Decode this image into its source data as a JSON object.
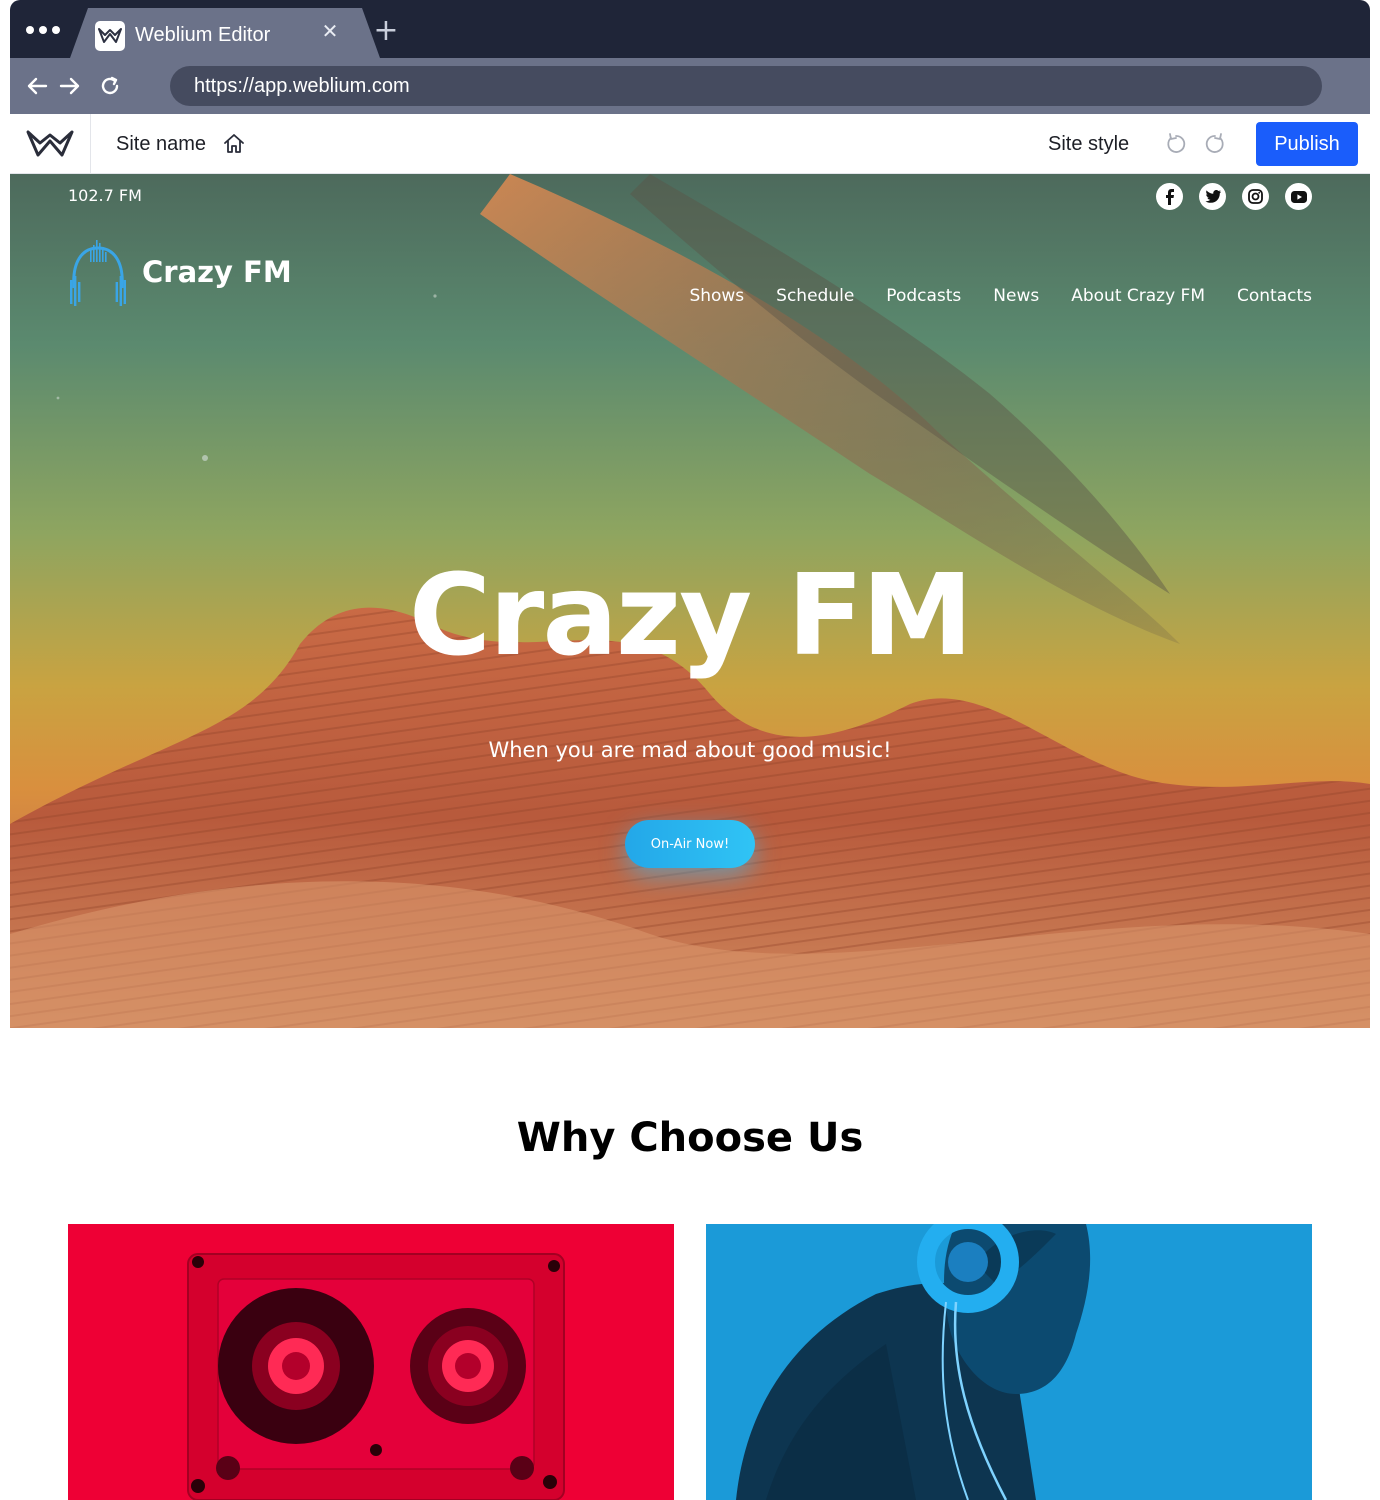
{
  "browser": {
    "tab_title": "Weblium Editor",
    "url": "https://app.weblium.com",
    "icons": [
      "menu-dots-icon",
      "weblium-favicon-icon",
      "close-icon",
      "plus-icon",
      "back-arrow-icon",
      "forward-arrow-icon",
      "reload-icon"
    ]
  },
  "editor": {
    "site_name": "Site name",
    "site_style": "Site style",
    "publish_label": "Publish",
    "accent_color": "#1a5dfb",
    "icons": [
      "weblium-logo-icon",
      "home-icon",
      "undo-icon",
      "redo-icon"
    ]
  },
  "site": {
    "frequency": "102.7 FM",
    "brand_name": "Crazy FM",
    "socials": [
      "facebook-icon",
      "twitter-icon",
      "instagram-icon",
      "youtube-icon"
    ],
    "nav": [
      "Shows",
      "Schedule",
      "Podcasts",
      "News",
      "About Crazy FM",
      "Contacts"
    ],
    "hero_title": "Crazy FM",
    "hero_subtitle": "When you are mad about good music!",
    "cta_label": "On-Air Now!",
    "section_title": "Why Choose Us",
    "card_colors": [
      "#ee0035",
      "#1b9ad8"
    ]
  }
}
